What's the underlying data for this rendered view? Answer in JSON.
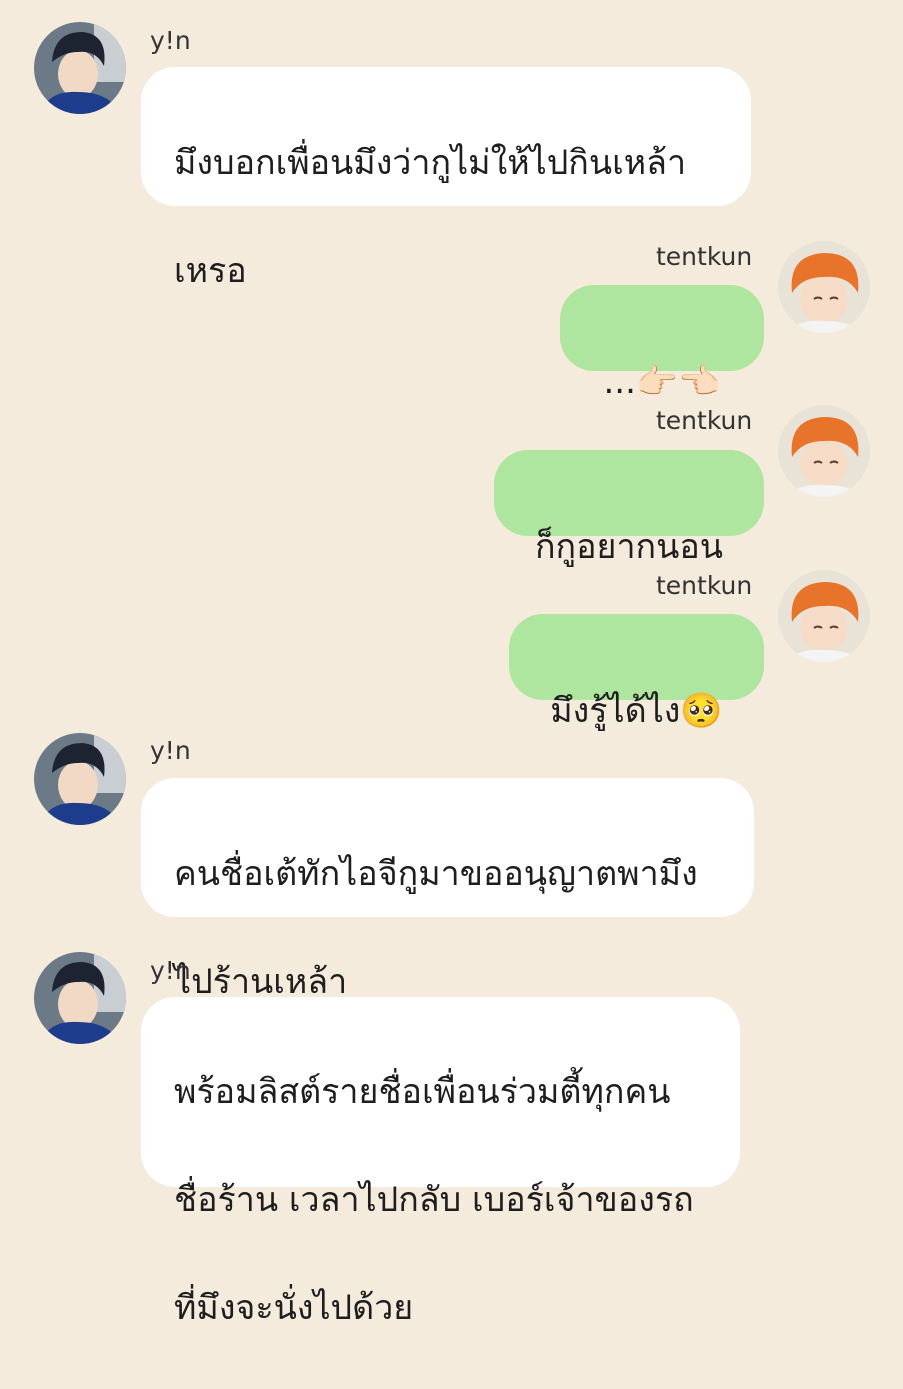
{
  "conversation": {
    "messages": [
      {
        "sender": "y!n",
        "side": "left",
        "lines": [
          "มึงบอกเพื่อนมึงว่ากูไม่ให้ไปกินเหล้า",
          "เหรอ"
        ]
      },
      {
        "sender": "tentkun",
        "side": "right",
        "text": "...👉🏻👈🏻"
      },
      {
        "sender": "tentkun",
        "side": "right",
        "text": "ก็กูอยากนอน"
      },
      {
        "sender": "tentkun",
        "side": "right",
        "text": "มึงรู้ได้ไง🥺"
      },
      {
        "sender": "y!n",
        "side": "left",
        "lines": [
          "คนชื่อเต้ทักไอจีกูมาขออนุญาตพามึง",
          "ไปร้านเหล้า"
        ]
      },
      {
        "sender": "y!n",
        "side": "left",
        "lines": [
          "พร้อมลิสต์รายชื่อเพื่อนร่วมตี้ทุกคน",
          "ชื่อร้าน เวลาไปกลับ เบอร์เจ้าของรถ",
          "ที่มึงจะนั่งไปด้วย"
        ]
      }
    ]
  },
  "colors": {
    "background": "#f5ebdd",
    "incoming_bubble": "#ffffff",
    "outgoing_bubble": "#aee59f"
  },
  "icons": {
    "incoming_avatar": "dark-haired-boy-avatar-icon",
    "outgoing_avatar": "orange-haired-boy-avatar-icon"
  }
}
